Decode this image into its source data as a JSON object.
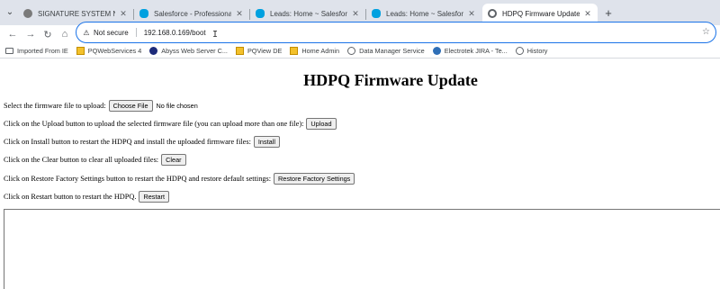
{
  "browser": {
    "tabs": [
      {
        "label": "SIGNATURE SYSTEM NODE BU",
        "active": false,
        "favicon": "signature-icon"
      },
      {
        "label": "Salesforce - Professional Editio",
        "active": false,
        "favicon": "salesforce-icon"
      },
      {
        "label": "Leads: Home ~ Salesforce - Pro",
        "active": false,
        "favicon": "salesforce-icon"
      },
      {
        "label": "Leads: Home ~ Salesforce - Pro",
        "active": false,
        "favicon": "salesforce-icon"
      },
      {
        "label": "HDPQ Firmware Update",
        "active": true,
        "favicon": "page-icon"
      }
    ],
    "tab_close_glyph": "✕",
    "new_tab_glyph": "+",
    "menu_glyph": "⌄",
    "nav": {
      "back": "←",
      "forward": "→",
      "reload": "↻",
      "home": "⌂"
    },
    "address_bar": {
      "security_text": "Not secure",
      "url": "192.168.0.169/boot",
      "star_glyph": "☆",
      "warning_glyph": "⚠"
    },
    "bookmarks": [
      {
        "label": "Imported From IE",
        "icon": "folder-icon"
      },
      {
        "label": "PQWebServices 4",
        "icon": "page-icon"
      },
      {
        "label": "Abyss Web Server C...",
        "icon": "abyss-icon"
      },
      {
        "label": "PQView DE",
        "icon": "page-icon"
      },
      {
        "label": "Home Admin",
        "icon": "page-icon"
      },
      {
        "label": "Data Manager Service",
        "icon": "data-icon"
      },
      {
        "label": "Electrotek JIRA - Te...",
        "icon": "globe-icon"
      },
      {
        "label": "History",
        "icon": "history-icon"
      }
    ]
  },
  "page": {
    "title": "HDPQ Firmware Update",
    "select_label": "Select the firmware file to upload:",
    "choose_file_label": "Choose File",
    "no_file_text": "No file chosen",
    "upload_text": "Click on the Upload button to upload the selected firmware file (you can upload more than one file):",
    "upload_button": "Upload",
    "install_text": "Click on Install button to restart the HDPQ and install the uploaded firmware files:",
    "install_button": "Install",
    "clear_text": "Click on the Clear button to clear all uploaded files:",
    "clear_button": "Clear",
    "restore_text": "Click on Restore Factory Settings button to restart the HDPQ and restore default settings:",
    "restore_button": "Restore Factory Settings",
    "restart_text": "Click on Restart button to restart the HDPQ.",
    "restart_button": "Restart",
    "output_text": ""
  }
}
